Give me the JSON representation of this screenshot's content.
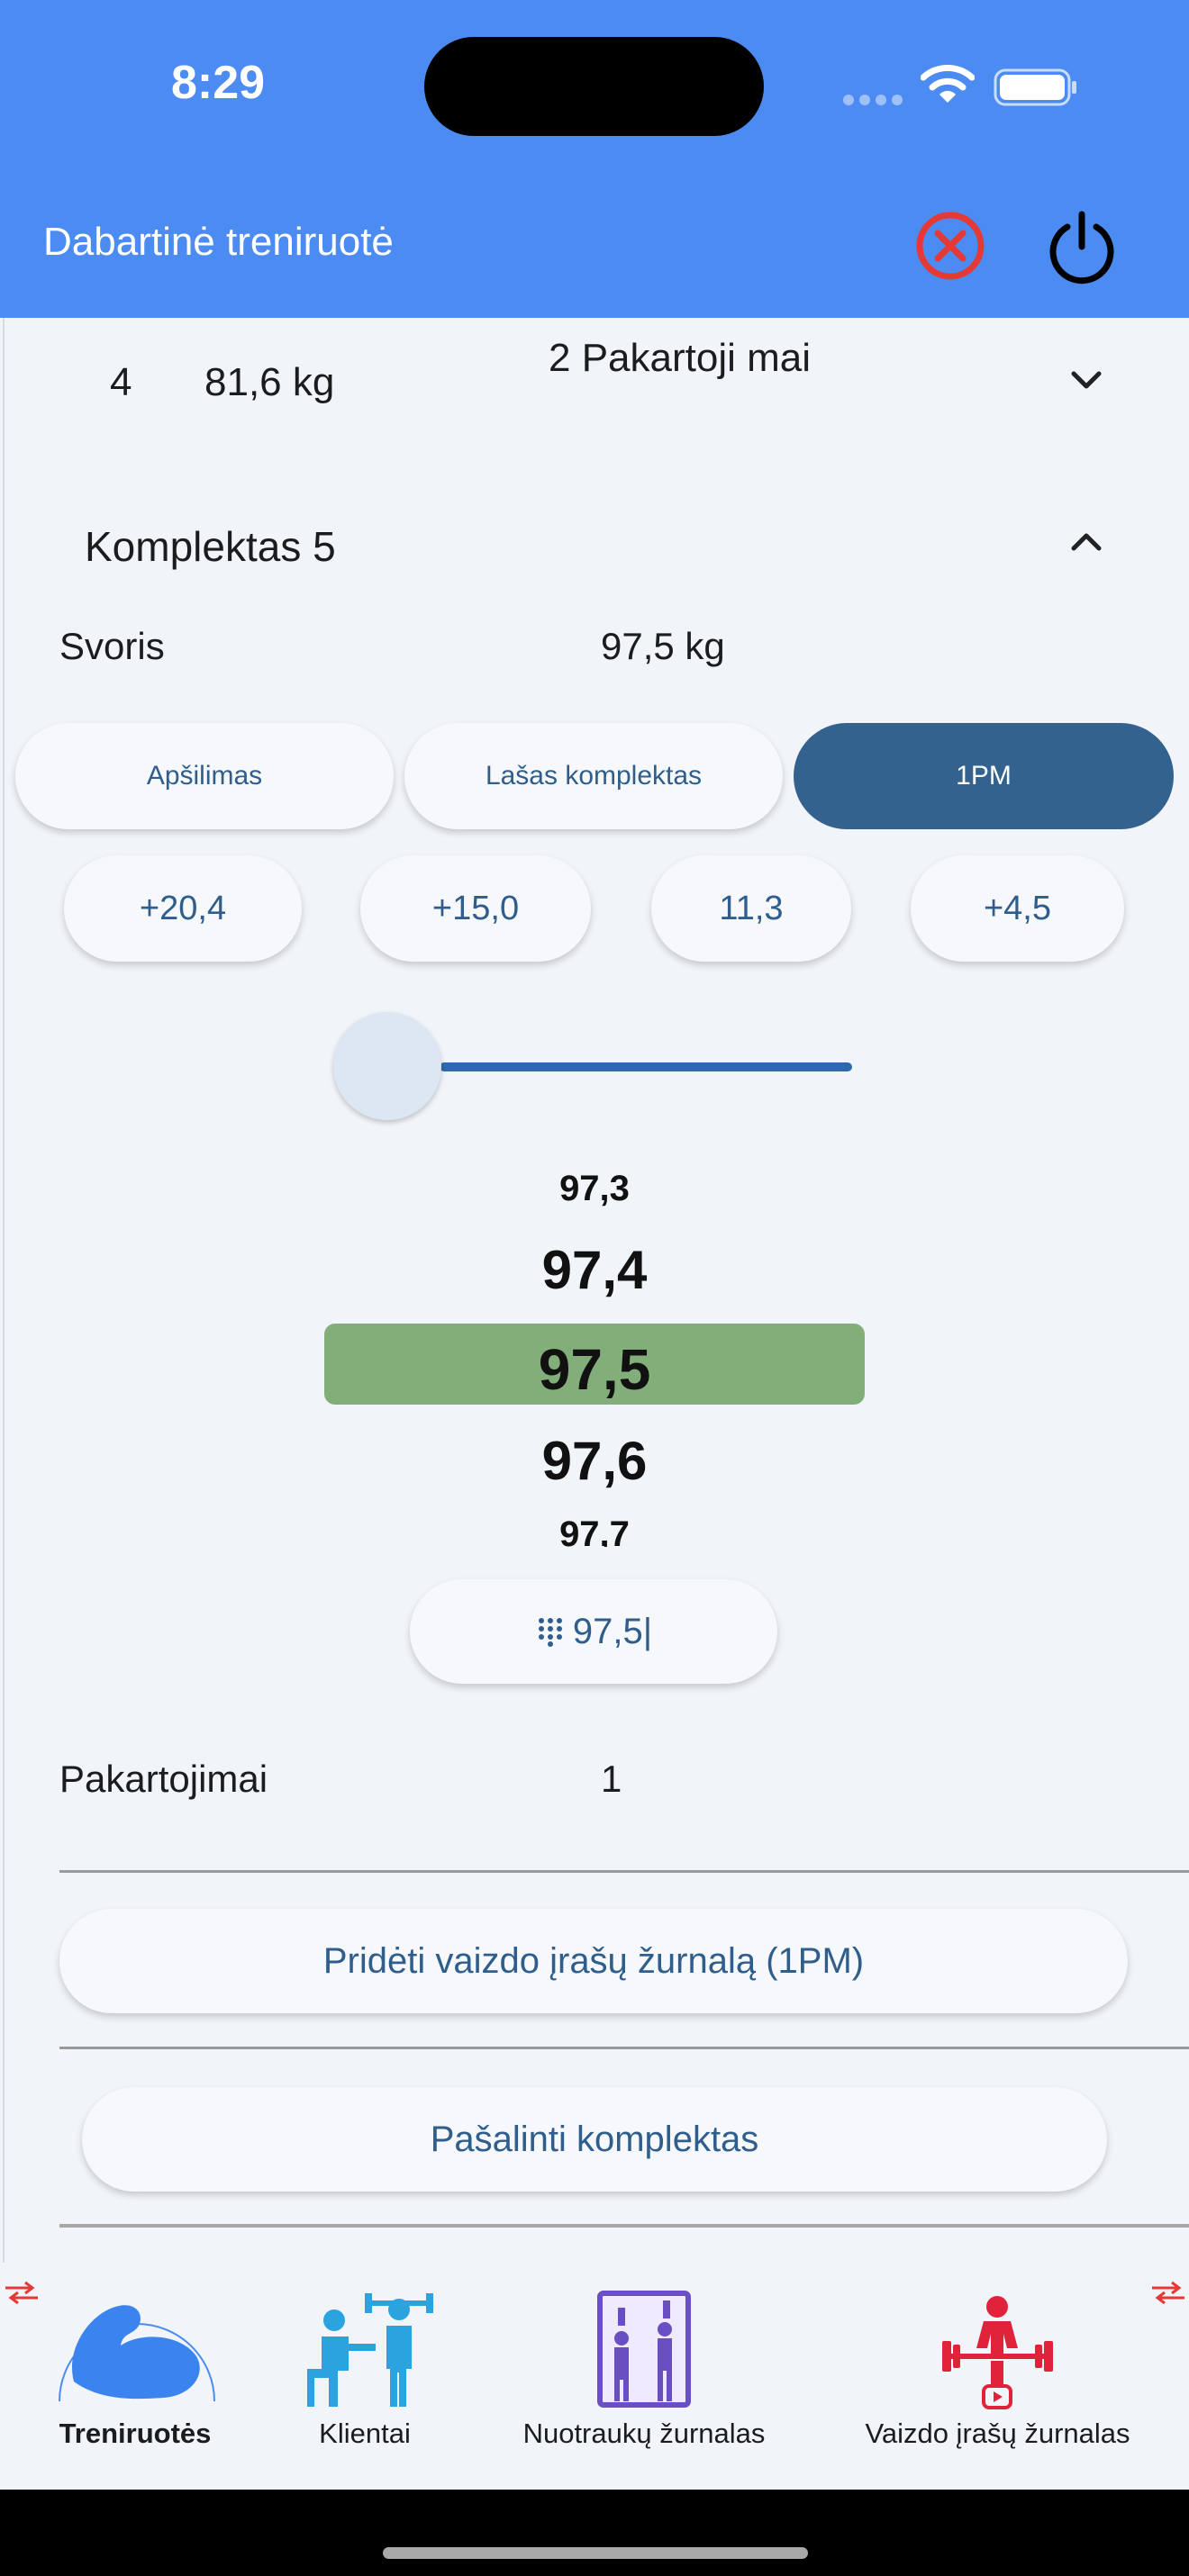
{
  "status_bar": {
    "time": "8:29"
  },
  "app_bar": {
    "title": "Dabartinė treniruotė"
  },
  "previous_set": {
    "number": "4",
    "weight": "81,6 kg",
    "reps": "2 Pakartoji mai"
  },
  "current_set": {
    "title": "Komplektas 5",
    "weight_label": "Svoris",
    "weight_value": "97,5 kg",
    "modes": [
      "Apšilimas",
      "Lašas komplektas",
      "1PM"
    ],
    "selected_mode": "1PM",
    "increments": [
      "+20,4",
      "+15,0",
      "11,3",
      "+4,5"
    ],
    "slider_level": 0.0,
    "picker": [
      "97,3",
      "97,4",
      "97,5",
      "97,6",
      "97,7"
    ],
    "picker_selected": "97,5",
    "keypad_value": "97,5|",
    "reps_label": "Pakartojimai",
    "reps_value": "1",
    "add_video_label": "Pridėti vaizdo įrašų žurnalą (1PM)",
    "remove_set_label": "Pašalinti komplektas"
  },
  "bottom_nav": {
    "items": [
      {
        "label": "Treniruotės",
        "icon": "flexed-arm-icon",
        "active": true
      },
      {
        "label": "Klientai",
        "icon": "trainer-client-icon"
      },
      {
        "label": "Nuotraukų žurnalas",
        "icon": "photo-mirror-icon"
      },
      {
        "label": "Vaizdo įrašų žurnalas",
        "icon": "weightlifter-video-icon"
      }
    ]
  },
  "colors": {
    "app_bar": "#4c8cf2",
    "accent": "#2f5e8c",
    "selected_mode": "#33628f",
    "picker_highlight": "#82ae7a",
    "cancel_icon": "#e53935"
  }
}
